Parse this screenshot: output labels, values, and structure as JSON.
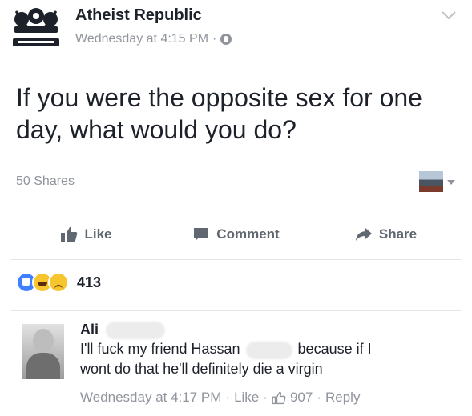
{
  "post": {
    "page_name": "Atheist Republic",
    "timestamp": "Wednesday at 4:15 PM",
    "meta_separator": "·",
    "body": "If you were the opposite sex for one day, what would you do?",
    "shares": "50 Shares"
  },
  "actions": {
    "like": "Like",
    "comment": "Comment",
    "share": "Share"
  },
  "reactions": {
    "count": "413",
    "types": [
      "like",
      "haha",
      "sad"
    ]
  },
  "comment": {
    "author": "Ali",
    "text_part1": "I'll fuck my friend Hassan",
    "text_part2": "because if I",
    "text_part3": "wont do that he'll definitely die a virgin",
    "timestamp": "Wednesday at 4:17 PM",
    "separator": "·",
    "like_label": "Like",
    "like_count": "907",
    "reply_label": "Reply"
  },
  "colors": {
    "text": "#1d2129",
    "secondary": "#90949c",
    "action": "#606770",
    "like_blue": "#4080ff",
    "haha_yellow": "#f7c52e"
  }
}
